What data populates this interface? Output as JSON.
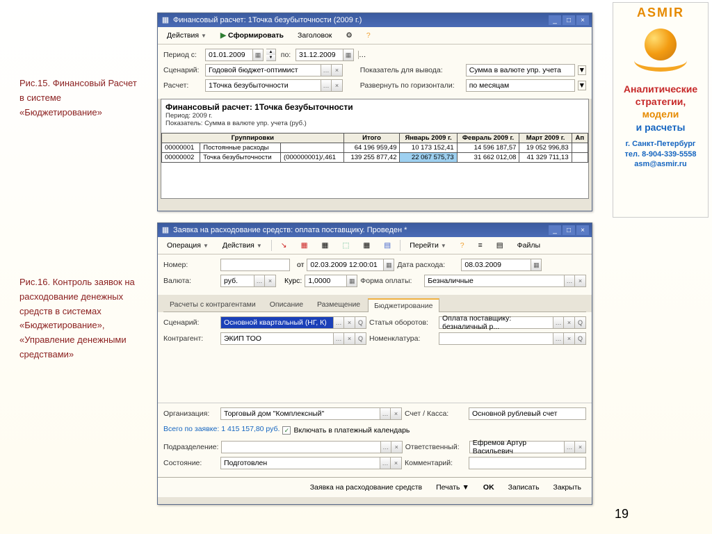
{
  "captions": {
    "c1": "Рис.15. Финансовый Расчет в системе «Бюджетирование»",
    "c2": "Рис.16. Контроль заявок на расходование денежных средств в системах «Бюджетирование», «Управление денежными средствами»"
  },
  "page_number": "19",
  "asmir": {
    "brand": "ASMIR",
    "l1": "Аналитические",
    "l2": "стратегии,",
    "l3": "модели",
    "l4": "и расчеты",
    "city": "г. Санкт-Петербург",
    "tel": "тел. 8-904-339-5558",
    "email": "asm@asmir.ru"
  },
  "win1": {
    "title": "Финансовый расчет: 1Точка безубыточности (2009 г.)",
    "toolbar": {
      "actions": "Действия",
      "form": "Сформировать",
      "headerBtn": "Заголовок"
    },
    "params": {
      "period_from_label": "Период с:",
      "period_from": "01.01.2009",
      "to_label": "по:",
      "period_to": "31.12.2009",
      "scenario_label": "Сценарий:",
      "scenario": "Годовой бюджет-оптимист",
      "calc_label": "Расчет:",
      "calc": "1Точка безубыточности",
      "indicator_label": "Показатель для вывода:",
      "indicator": "Сумма в валюте упр. учета",
      "expand_label": "Развернуть по горизонтали:",
      "expand": "по месяцам"
    },
    "report": {
      "title": "Финансовый расчет: 1Точка безубыточности",
      "sub1": "Период: 2009 г.",
      "sub2": "Показатель: Сумма в валюте упр. учета (руб.)",
      "headers": [
        "Группировки",
        "Итого",
        "Январь 2009 г.",
        "Февраль 2009 г.",
        "Март 2009 г.",
        "Ап"
      ],
      "rows": [
        {
          "code": "00000001",
          "name": "Постоянные расходы",
          "sub": "",
          "itogo": "64 196 959,49",
          "m1": "10 173 152,41",
          "m2": "14 596 187,57",
          "m3": "19 052 996,83"
        },
        {
          "code": "00000002",
          "name": "Точка безубыточности",
          "sub": "(000000001)/,461",
          "itogo": "139 255 877,42",
          "m1": "22 067 575,73",
          "m2": "31 662 012,08",
          "m3": "41 329 711,13"
        }
      ]
    }
  },
  "win2": {
    "title": "Заявка на расходование средств: оплата поставщику. Проведен *",
    "toolbar": {
      "operation": "Операция",
      "actions": "Действия",
      "goto": "Перейти",
      "files": "Файлы"
    },
    "fields": {
      "number_label": "Номер:",
      "number": "",
      "from_label": "от",
      "from": "02.03.2009 12:00:01",
      "date_label": "Дата расхода:",
      "date": "08.03.2009",
      "currency_label": "Валюта:",
      "currency": "руб.",
      "rate_label": "Курс:",
      "rate": "1,0000",
      "form_label": "Форма оплаты:",
      "form": "Безналичные",
      "tabs": [
        "Расчеты с контрагентами",
        "Описание",
        "Размещение",
        "Бюджетирование"
      ],
      "scenario_label": "Сценарий:",
      "scenario": "Основной квартальный (НГ, К)",
      "article_label": "Статья оборотов:",
      "article": "Оплата поставщику: безналичный р...",
      "counterparty_label": "Контрагент:",
      "counterparty": "ЭКИП ТОО",
      "nomenclature_label": "Номенклатура:",
      "nomenclature": "",
      "org_label": "Организация:",
      "org": "Торговый дом \"Комплексный\"",
      "account_label": "Счет / Касса:",
      "account": "Основной рублевый счет",
      "total_label": "Всего по заявке:",
      "total": "1 415 157,80 руб.",
      "include_calendar": "Включать в платежный календарь",
      "dept_label": "Подразделение:",
      "dept": "",
      "responsible_label": "Ответственный:",
      "responsible": "Ефремов Артур Васильевич",
      "status_label": "Состояние:",
      "status": "Подготовлен",
      "comment_label": "Комментарий:",
      "comment": ""
    },
    "footer": {
      "request": "Заявка на расходование средств",
      "print": "Печать",
      "ok": "OK",
      "write": "Записать",
      "close": "Закрыть"
    }
  }
}
